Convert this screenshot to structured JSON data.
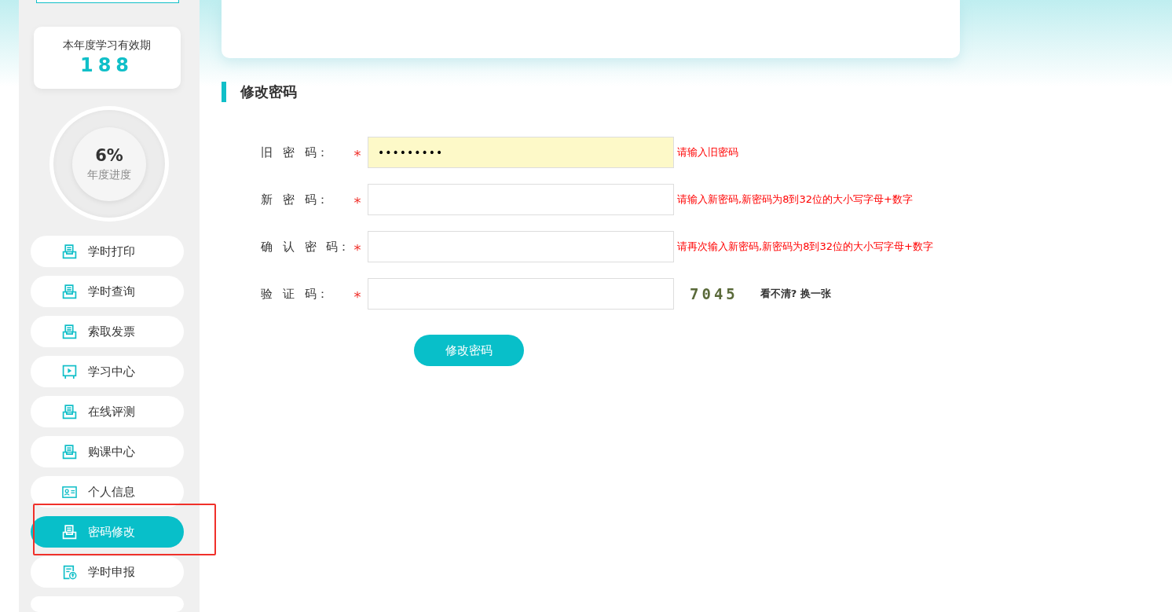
{
  "validity": {
    "label": "本年度学习有效期",
    "value": "188"
  },
  "progress": {
    "percent": "6%",
    "label": "年度进度"
  },
  "menu": [
    {
      "label": "学时打印",
      "kind": "doc",
      "selected": false
    },
    {
      "label": "学时查询",
      "kind": "doc",
      "selected": false
    },
    {
      "label": "索取发票",
      "kind": "doc",
      "selected": false
    },
    {
      "label": "学习中心",
      "kind": "play",
      "selected": false
    },
    {
      "label": "在线评测",
      "kind": "doc",
      "selected": false
    },
    {
      "label": "购课中心",
      "kind": "doc",
      "selected": false
    },
    {
      "label": "个人信息",
      "kind": "card",
      "selected": false
    },
    {
      "label": "密码修改",
      "kind": "doc",
      "selected": true
    },
    {
      "label": "学时申报",
      "kind": "report",
      "selected": false
    }
  ],
  "section_title": "修改密码",
  "form": [
    {
      "kind": "input",
      "label": "旧 密 码：",
      "value": "•••••••••",
      "autofilled": true,
      "hint": "请输入旧密码"
    },
    {
      "kind": "input",
      "label": "新 密 码：",
      "autofilled": false,
      "hint": "请输入新密码,新密码为8到32位的大小写字母+数字"
    },
    {
      "kind": "input",
      "label": "确 认 密 码：",
      "autofilled": false,
      "hint": "请再次输入新密码,新密码为8到32位的大小写字母+数字"
    },
    {
      "kind": "captcha",
      "label": "验 证 码：",
      "autofilled": false,
      "captcha": "7045",
      "refresh": "看不清? 换一张"
    }
  ],
  "required_mark": "*",
  "submit": "修改密码"
}
